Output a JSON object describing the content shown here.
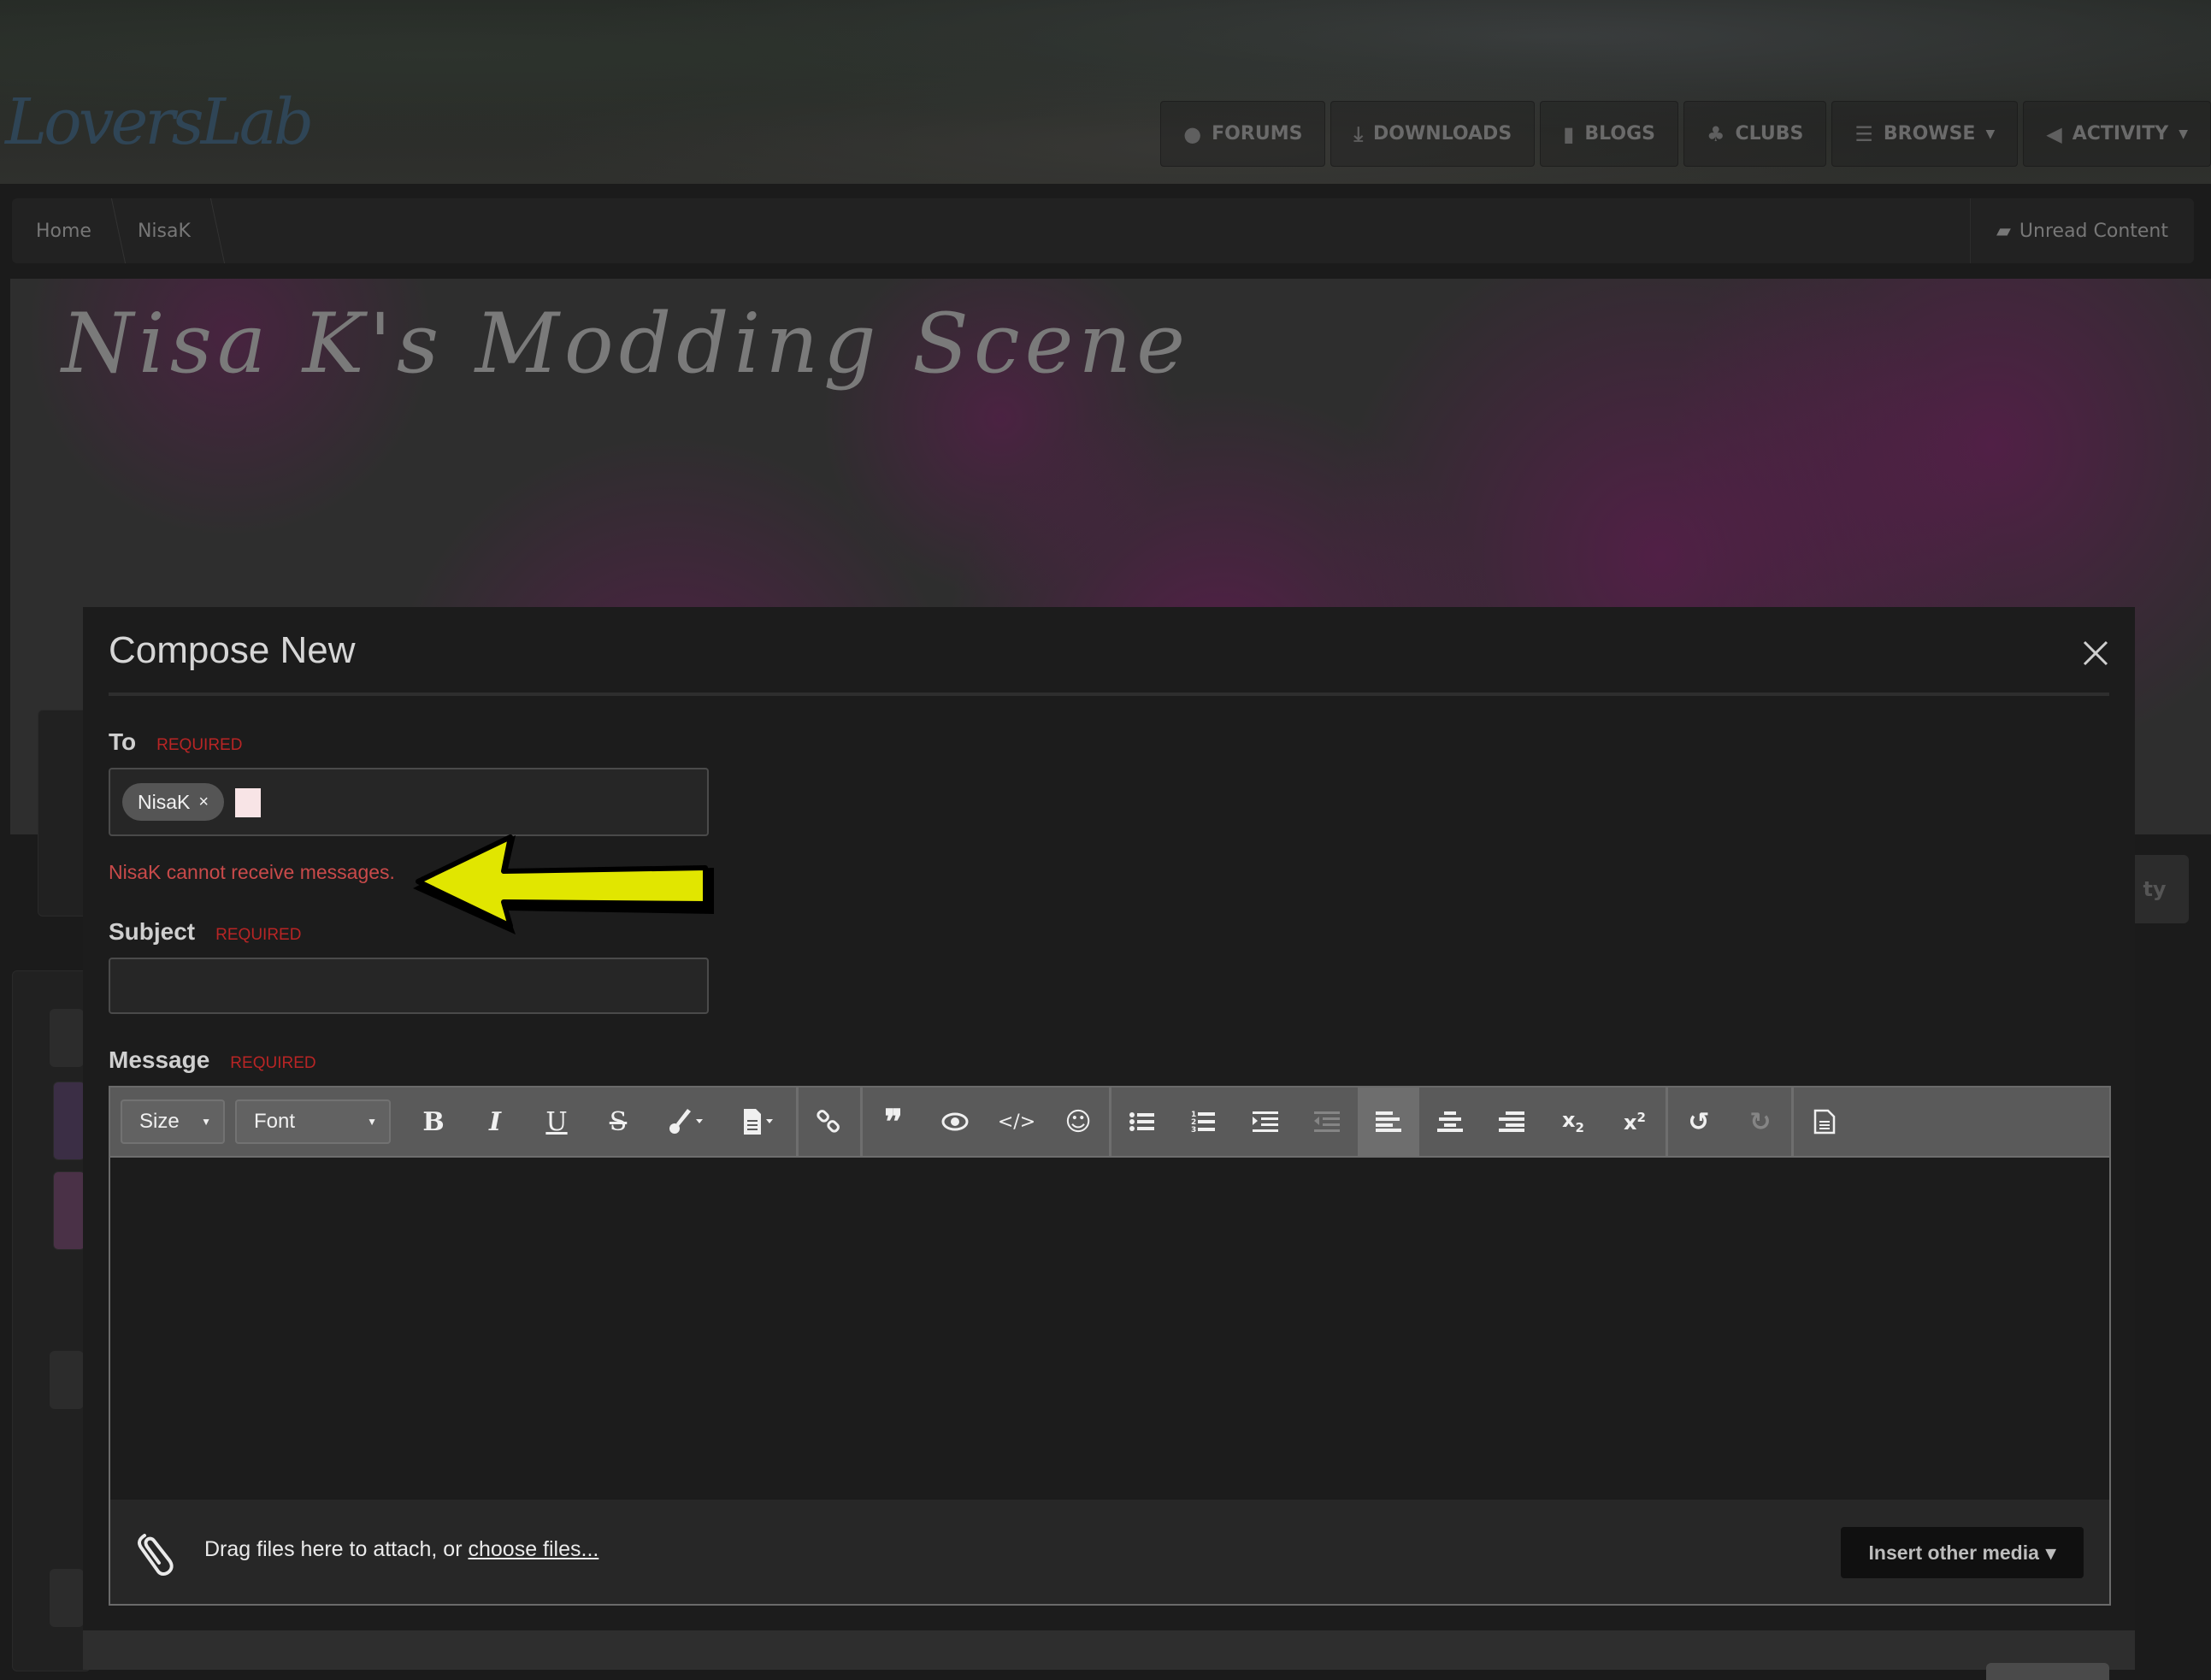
{
  "header": {
    "logo": "LoversLab",
    "nav": [
      {
        "label": "FORUMS",
        "icon": "comments-icon",
        "glyph": "💬",
        "dropdown": false
      },
      {
        "label": "DOWNLOADS",
        "icon": "download-icon",
        "glyph": "⤓",
        "dropdown": false
      },
      {
        "label": "BLOGS",
        "icon": "book-icon",
        "glyph": "📘",
        "dropdown": false
      },
      {
        "label": "CLUBS",
        "icon": "users-icon",
        "glyph": "👥",
        "dropdown": false
      },
      {
        "label": "BROWSE",
        "icon": "list-icon",
        "glyph": "☰",
        "dropdown": true
      },
      {
        "label": "ACTIVITY",
        "icon": "bullhorn-icon",
        "glyph": "📢",
        "dropdown": true
      }
    ]
  },
  "breadcrumb": {
    "items": [
      "Home",
      "NisaK"
    ],
    "unread": "Unread Content"
  },
  "profile": {
    "cover_title": "Nisa K's Modding Scene",
    "partial_button": "ty"
  },
  "modal": {
    "title": "Compose New",
    "required_label": "REQUIRED",
    "to": {
      "label": "To",
      "recipients": [
        "NisaK"
      ],
      "remove_glyph": "×",
      "error": "NisaK cannot receive messages."
    },
    "subject": {
      "label": "Subject",
      "value": "",
      "placeholder": ""
    },
    "message": {
      "label": "Message",
      "toolbar": {
        "size_label": "Size",
        "font_label": "Font",
        "buttons": [
          {
            "name": "bold",
            "glyph": "B"
          },
          {
            "name": "italic",
            "glyph": "I"
          },
          {
            "name": "underline",
            "glyph": "U"
          },
          {
            "name": "strikethrough",
            "glyph": "S"
          },
          {
            "name": "color",
            "glyph": "🖌"
          },
          {
            "name": "paste",
            "glyph": "📄"
          },
          {
            "name": "link",
            "glyph": "🔗"
          },
          {
            "name": "quote",
            "glyph": "❞"
          },
          {
            "name": "spoiler",
            "glyph": "👁"
          },
          {
            "name": "code",
            "glyph": "</>"
          },
          {
            "name": "emoji",
            "glyph": "☺"
          },
          {
            "name": "bullet-list",
            "glyph": "☰"
          },
          {
            "name": "numbered-list",
            "glyph": "☷"
          },
          {
            "name": "indent",
            "glyph": "⇥"
          },
          {
            "name": "outdent",
            "glyph": "⇤"
          },
          {
            "name": "align-left",
            "glyph": "☰",
            "active": true
          },
          {
            "name": "align-center",
            "glyph": "☰"
          },
          {
            "name": "align-right",
            "glyph": "☰"
          },
          {
            "name": "subscript",
            "glyph": "x₂"
          },
          {
            "name": "superscript",
            "glyph": "x²"
          },
          {
            "name": "undo",
            "glyph": "↺"
          },
          {
            "name": "redo",
            "glyph": "↻",
            "disabled": true
          },
          {
            "name": "source",
            "glyph": "🗎"
          }
        ]
      },
      "attach_text": "Drag files here to attach, or ",
      "attach_link": "choose files...",
      "insert_media": "Insert other media",
      "insert_media_caret": "▾"
    }
  },
  "colors": {
    "required": "#b82525",
    "error": "#c94a4a",
    "annotation_arrow": "#e1e600",
    "toolbar": "#5a5a5a"
  }
}
